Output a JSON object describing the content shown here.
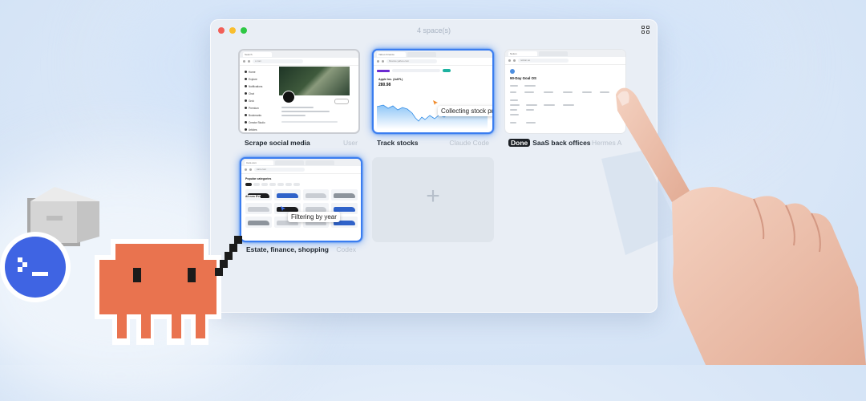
{
  "window": {
    "title": "4 space(s)"
  },
  "spaces": [
    {
      "name": "Scrape social media",
      "agent": "User",
      "done": false,
      "mini": {
        "url": "x.com",
        "tab": "Search",
        "sidebar": [
          "Home",
          "Explore",
          "Notifications",
          "Chat",
          "Grok",
          "Premium",
          "Bookmarks",
          "Creator Studio",
          "Articles"
        ]
      }
    },
    {
      "name": "Track stocks",
      "agent": "Claude Code",
      "done": false,
      "mini": {
        "url": "finance.yahoo.com",
        "tab": "Yahoo Finance",
        "ticker": "Apple Inc. (AAPL)",
        "price": "280.98"
      },
      "tooltip": "Collecting stock pric"
    },
    {
      "name": "SaaS back offices",
      "agent": "Hermes A",
      "done": true,
      "done_label": "Done",
      "mini": {
        "url": "notion.so",
        "tab": "Notion",
        "heading": "90-Day Goal OS"
      }
    },
    {
      "name": "Estate, finance, shopping",
      "agent": "Codex",
      "done": false,
      "mini": {
        "url": "cars.com",
        "tab": "Cars.com",
        "heading": "Popular categories",
        "sub": "All new EVs"
      },
      "tooltip": "Filtering by year"
    }
  ],
  "add_space": {
    "symbol": "+"
  },
  "icons": {
    "window_grid": "grid-icon",
    "terminal": "terminal-icon",
    "mascot": "pixel-creature-icon",
    "box": "box-icon",
    "hand": "hand-icon"
  },
  "colors": {
    "accent": "#3a7df0",
    "mascot": "#e9734f",
    "terminal": "#3f64e3"
  }
}
